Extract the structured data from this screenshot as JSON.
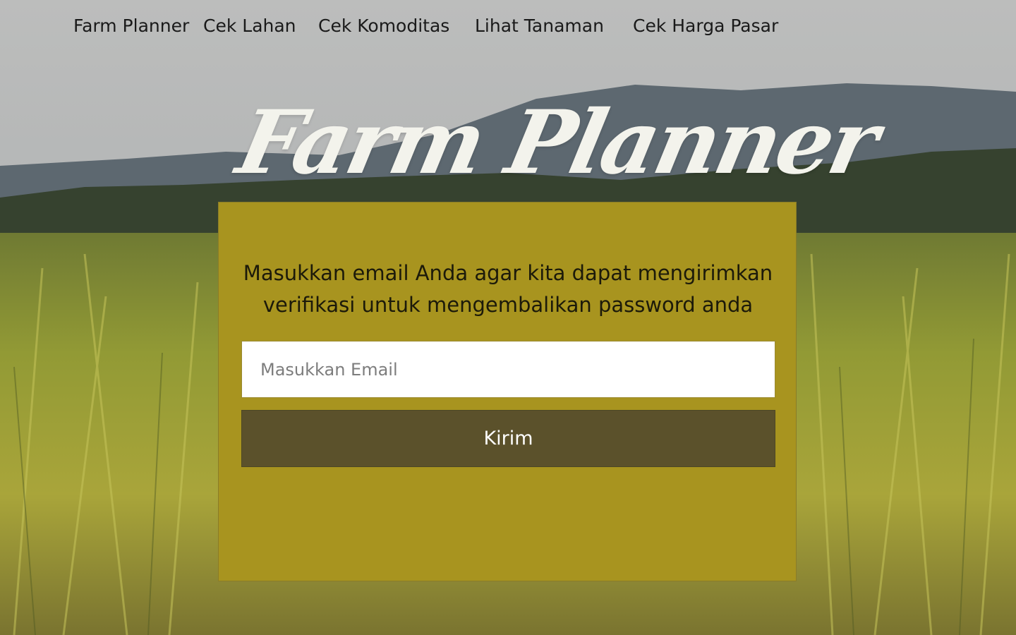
{
  "nav": {
    "brand": "Farm Planner",
    "items": [
      {
        "label": "Cek Lahan"
      },
      {
        "label": "Cek Komoditas"
      },
      {
        "label": "Lihat Tanaman"
      },
      {
        "label": "Cek Harga Pasar"
      }
    ]
  },
  "hero": {
    "title": "Farm Planner"
  },
  "form": {
    "instruction": "Masukkan email Anda agar kita dapat mengirimkan verifikasi untuk mengembalikan password anda",
    "email_value": "",
    "email_placeholder": "Masukkan Email",
    "submit_label": "Kirim"
  },
  "colors": {
    "panel": "#a8941f",
    "button": "#5b512b",
    "title": "#f3f3ec"
  }
}
